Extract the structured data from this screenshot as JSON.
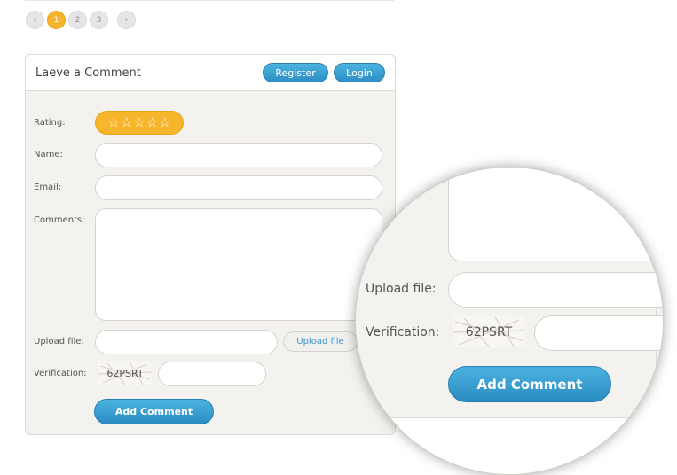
{
  "pagination": {
    "prev_icon": "‹",
    "pages": [
      "1",
      "2",
      "3"
    ],
    "active_page": "1",
    "next_icon": "›"
  },
  "comment_form": {
    "title": "Laeve a Comment",
    "register_label": "Register",
    "login_label": "Login",
    "rating_label": "Rating:",
    "rating_star": "☆",
    "name_label": "Name:",
    "email_label": "Email:",
    "comments_label": "Comments:",
    "upload_label": "Upload file:",
    "upload_button": "Upload file",
    "verification_label": "Verification:",
    "captcha_text": "62PSRT",
    "submit_label": "Add Comment"
  },
  "magnifier": {
    "upload_label": "Upload file:",
    "verification_label": "Verification:",
    "captcha_text": "62PSRT",
    "submit_label": "Add Comment"
  },
  "colors": {
    "accent_orange": "#f7b52c",
    "button_blue": "#2d8fc5",
    "panel_bg": "#f4f2ee"
  }
}
